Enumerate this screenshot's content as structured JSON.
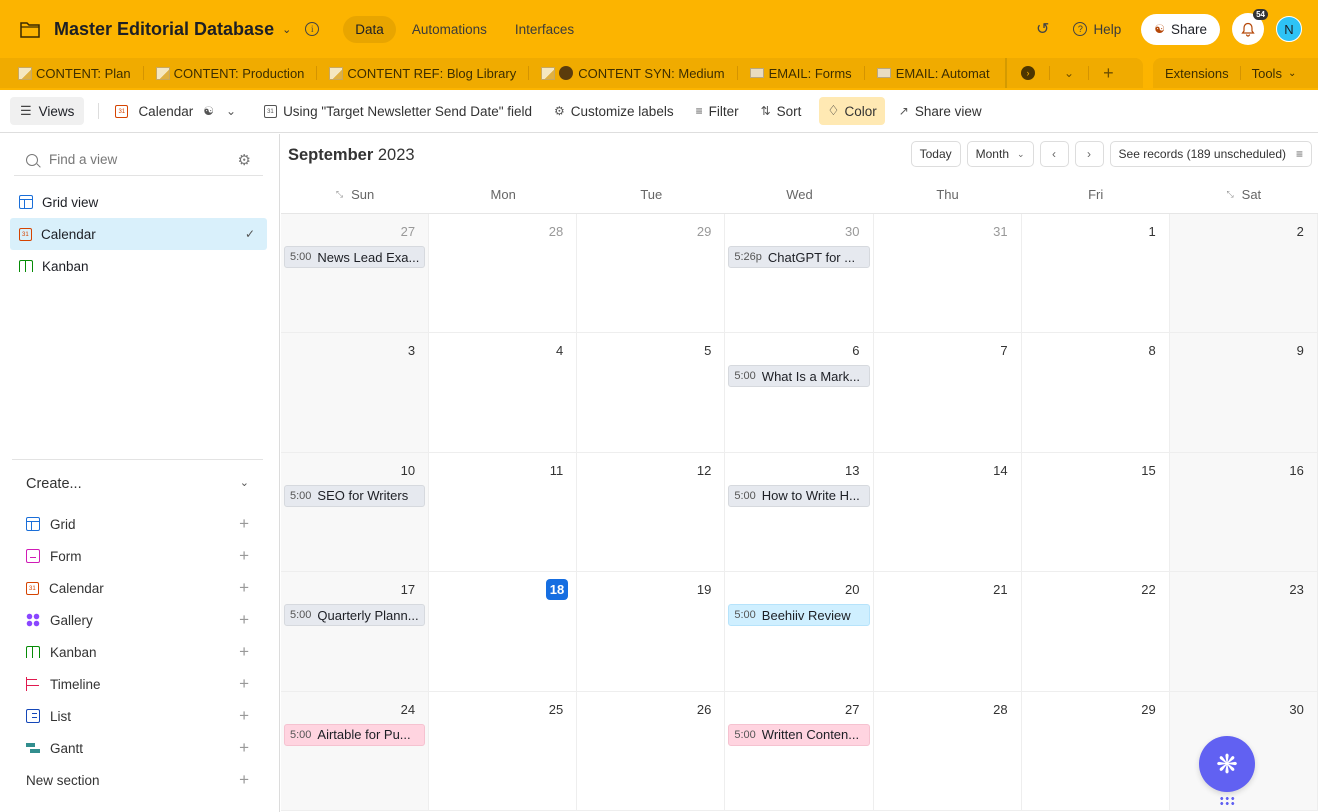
{
  "app": {
    "base_title": "Master Editorial Database",
    "top_tabs": [
      {
        "label": "Data",
        "active": true
      },
      {
        "label": "Automations",
        "active": false
      },
      {
        "label": "Interfaces",
        "active": false
      }
    ],
    "help_label": "Help",
    "share_label": "Share",
    "notifications_count": "54",
    "avatar_initial": "N"
  },
  "tables": {
    "items": [
      {
        "label": "CONTENT: Plan",
        "icon": "memo-icon"
      },
      {
        "label": "CONTENT: Production",
        "icon": "memo-icon"
      },
      {
        "label": "CONTENT REF: Blog Library",
        "icon": "memo-icon"
      },
      {
        "label": "CONTENT SYN: Medium",
        "icon": "memo-ball-icon"
      },
      {
        "label": "EMAIL: Forms",
        "icon": "envelope-icon"
      },
      {
        "label": "EMAIL: Automat",
        "icon": "envelope-icon"
      }
    ],
    "extensions_label": "Extensions",
    "tools_label": "Tools"
  },
  "toolbar": {
    "views_label": "Views",
    "view_name": "Calendar",
    "date_field_label": "Using \"Target Newsletter Send Date\" field",
    "customize_label": "Customize labels",
    "filter_label": "Filter",
    "sort_label": "Sort",
    "color_label": "Color",
    "share_view_label": "Share view"
  },
  "sidebar": {
    "find_placeholder": "Find a view",
    "views": [
      {
        "label": "Grid view",
        "type": "grid",
        "active": false
      },
      {
        "label": "Calendar",
        "type": "calendar",
        "active": true
      },
      {
        "label": "Kanban",
        "type": "kanban",
        "active": false
      }
    ],
    "create_label": "Create...",
    "create_items": [
      {
        "label": "Grid",
        "type": "grid"
      },
      {
        "label": "Form",
        "type": "form"
      },
      {
        "label": "Calendar",
        "type": "calendar"
      },
      {
        "label": "Gallery",
        "type": "gallery"
      },
      {
        "label": "Kanban",
        "type": "kanban"
      },
      {
        "label": "Timeline",
        "type": "timeline"
      },
      {
        "label": "List",
        "type": "list"
      },
      {
        "label": "Gantt",
        "type": "gantt"
      }
    ],
    "new_section_label": "New section"
  },
  "calendar": {
    "month": "September",
    "year": "2023",
    "today_label": "Today",
    "range_label": "Month",
    "see_records_label": "See records (189 unscheduled)",
    "weekdays": [
      "Sun",
      "Mon",
      "Tue",
      "Wed",
      "Thu",
      "Fri",
      "Sat"
    ],
    "weeks": [
      [
        {
          "day": "27",
          "other": true,
          "event": {
            "time": "5:00",
            "title": "News Lead Exa...",
            "color": "gray"
          }
        },
        {
          "day": "28",
          "other": true
        },
        {
          "day": "29",
          "other": true
        },
        {
          "day": "30",
          "other": true,
          "event": {
            "time": "5:26p",
            "title": "ChatGPT for ...",
            "color": "gray"
          }
        },
        {
          "day": "31",
          "other": true
        },
        {
          "day": "1"
        },
        {
          "day": "2"
        }
      ],
      [
        {
          "day": "3"
        },
        {
          "day": "4"
        },
        {
          "day": "5"
        },
        {
          "day": "6",
          "event": {
            "time": "5:00",
            "title": "What Is a Mark...",
            "color": "gray"
          }
        },
        {
          "day": "7"
        },
        {
          "day": "8"
        },
        {
          "day": "9"
        }
      ],
      [
        {
          "day": "10",
          "event": {
            "time": "5:00",
            "title": "SEO for Writers",
            "color": "gray"
          }
        },
        {
          "day": "11"
        },
        {
          "day": "12"
        },
        {
          "day": "13",
          "event": {
            "time": "5:00",
            "title": "How to Write H...",
            "color": "gray"
          }
        },
        {
          "day": "14"
        },
        {
          "day": "15"
        },
        {
          "day": "16"
        }
      ],
      [
        {
          "day": "17",
          "event": {
            "time": "5:00",
            "title": "Quarterly Plann...",
            "color": "gray"
          }
        },
        {
          "day": "18",
          "today": true
        },
        {
          "day": "19"
        },
        {
          "day": "20",
          "event": {
            "time": "5:00",
            "title": "Beehiiv Review",
            "color": "blue"
          }
        },
        {
          "day": "21"
        },
        {
          "day": "22"
        },
        {
          "day": "23"
        }
      ],
      [
        {
          "day": "24",
          "event": {
            "time": "5:00",
            "title": "Airtable for Pu...",
            "color": "pink"
          }
        },
        {
          "day": "25"
        },
        {
          "day": "26"
        },
        {
          "day": "27",
          "event": {
            "time": "5:00",
            "title": "Written Conten...",
            "color": "pink"
          }
        },
        {
          "day": "28"
        },
        {
          "day": "29"
        },
        {
          "day": "30"
        }
      ]
    ]
  },
  "colors": {
    "brand_yellow": "#fcb400",
    "today_blue": "#166ee1",
    "active_view_bg": "#d9f0fb",
    "fab_purple": "#6161f2"
  }
}
